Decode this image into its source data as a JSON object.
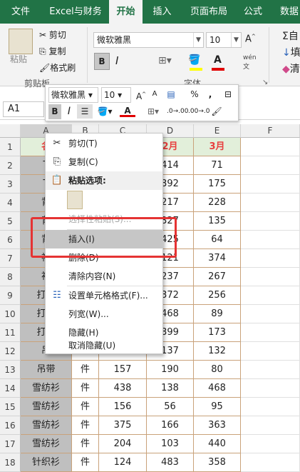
{
  "ribbon": {
    "tabs": [
      "文件",
      "Excel与财务",
      "开始",
      "插入",
      "页面布局",
      "公式",
      "数据"
    ],
    "active_tab": "开始",
    "clipboard": {
      "paste": "粘贴",
      "cut": "剪切",
      "copy": "复制",
      "format_painter": "格式刷",
      "group_label": "剪贴板"
    },
    "font": {
      "name": "微软雅黑",
      "size": "10",
      "bold": "B",
      "group_label": "字体"
    },
    "right": {
      "r1": "自",
      "r2": "填",
      "r3": "清",
      "wen": "wén",
      "wen2": "文"
    }
  },
  "namebox": "A1",
  "columns": [
    "A",
    "B",
    "C",
    "D",
    "E",
    "F"
  ],
  "rows": [
    {
      "n": "1",
      "a": "名",
      "d": "2月",
      "e": "3月"
    },
    {
      "n": "2",
      "a": "T",
      "d": "414",
      "e": "71"
    },
    {
      "n": "3",
      "a": "T",
      "d": "392",
      "e": "175"
    },
    {
      "n": "4",
      "a": "背",
      "d": "217",
      "e": "228"
    },
    {
      "n": "5",
      "a": "背",
      "d": "327",
      "e": "135"
    },
    {
      "n": "6",
      "a": "背",
      "d": "425",
      "e": "64"
    },
    {
      "n": "7",
      "a": "衬",
      "d": "121",
      "e": "374"
    },
    {
      "n": "8",
      "a": "衬",
      "d": "237",
      "e": "267"
    },
    {
      "n": "9",
      "a": "打底",
      "d": "372",
      "e": "256"
    },
    {
      "n": "10",
      "a": "打底",
      "d": "468",
      "e": "89"
    },
    {
      "n": "11",
      "a": "打底",
      "d": "399",
      "e": "173"
    },
    {
      "n": "12",
      "a": "吊",
      "d": "137",
      "e": "132"
    },
    {
      "n": "13",
      "a": "吊带",
      "b": "件",
      "c": "157",
      "d": "190",
      "e": "80"
    },
    {
      "n": "14",
      "a": "雪纺衫",
      "b": "件",
      "c": "438",
      "d": "138",
      "e": "468"
    },
    {
      "n": "15",
      "a": "雪纺衫",
      "b": "件",
      "c": "156",
      "d": "56",
      "e": "95"
    },
    {
      "n": "16",
      "a": "雪纺衫",
      "b": "件",
      "c": "375",
      "d": "166",
      "e": "363"
    },
    {
      "n": "17",
      "a": "雪纺衫",
      "b": "件",
      "c": "204",
      "d": "103",
      "e": "440"
    },
    {
      "n": "18",
      "a": "针织衫",
      "b": "件",
      "c": "124",
      "d": "483",
      "e": "358"
    }
  ],
  "mini_toolbar": {
    "font": "微软雅黑",
    "size": "10",
    "bold": "B",
    "italic": "I",
    "percent": "%",
    "comma": ","
  },
  "context_menu": {
    "cut": "剪切(T)",
    "copy": "复制(C)",
    "paste_options": "粘贴选项:",
    "paste_special": "选择性粘贴(S)...",
    "insert": "插入(I)",
    "delete": "删除(D)",
    "clear": "清除内容(N)",
    "format_cells": "设置单元格格式(F)...",
    "col_width": "列宽(W)...",
    "hide": "隐藏(H)",
    "unhide": "取消隐藏(U)"
  },
  "colors": {
    "excel_green": "#217346",
    "header_fill": "#e2efda",
    "header_text": "#e83e3e",
    "highlight_box": "#e53333"
  }
}
